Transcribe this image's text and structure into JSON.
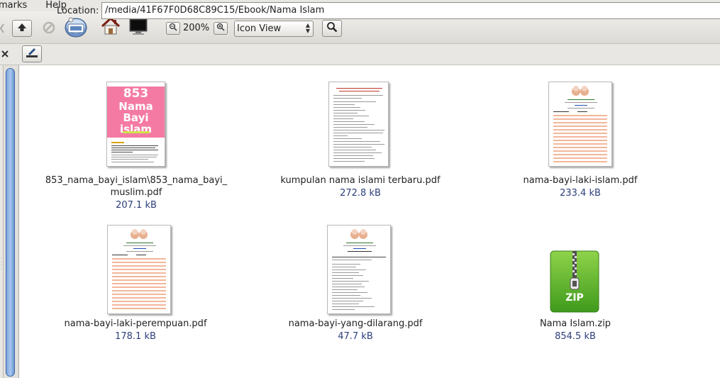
{
  "menubar": {
    "items": [
      "marks",
      "Help"
    ]
  },
  "toolbar": {
    "zoom_level": "200%",
    "view_mode": "Icon View"
  },
  "location": {
    "label": "Location:",
    "value": "/media/41F67F0D68C89C15/Ebook/Nama Islam"
  },
  "files": [
    {
      "name_line1": "853_nama_bayi_islam\\853_nama_bayi_",
      "name_line2": "muslim.pdf",
      "size": "207.1 kB"
    },
    {
      "name": "kumpulan nama islami terbaru.pdf",
      "size": "272.8 kB"
    },
    {
      "name": "nama-bayi-laki-islam.pdf",
      "size": "233.4 kB"
    },
    {
      "name": "nama-bayi-laki-perempuan.pdf",
      "size": "178.1 kB"
    },
    {
      "name": "nama-bayi-yang-dilarang.pdf",
      "size": "47.7 kB"
    },
    {
      "name": "Nama Islam.zip",
      "size": "854.5 kB"
    }
  ],
  "thumb1": {
    "number": "853",
    "word1": "Nama",
    "word2": "Bayi",
    "word3": "islam"
  },
  "zip_label": "ZIP",
  "icons": [
    "up-arrow-icon",
    "stop-icon",
    "network-icon",
    "home-icon",
    "computer-icon",
    "zoom-out-icon",
    "zoom-in-icon",
    "search-icon",
    "close-icon",
    "edit-location-icon"
  ],
  "colors": {
    "accent": "#3b67a8",
    "size_text": "#2c3e7a",
    "zip_green": "#5cb82a",
    "thumb_pink": "#f47aa4"
  }
}
